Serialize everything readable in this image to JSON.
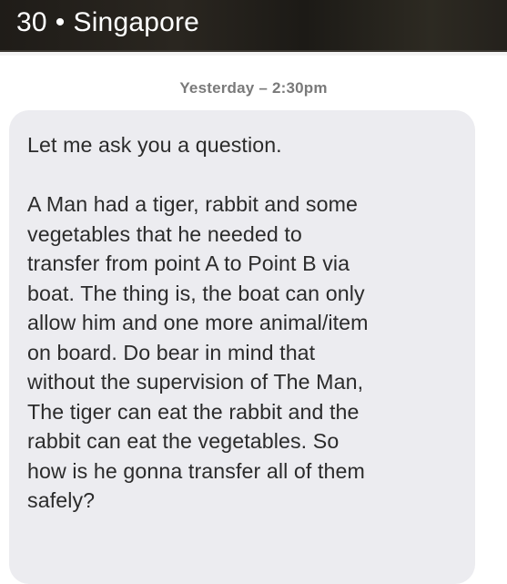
{
  "header": {
    "age": "30",
    "separator": "•",
    "location": "Singapore"
  },
  "timestamp": "Yesterday – 2:30pm",
  "message": {
    "first_line": "Let me ask you a question.",
    "lines": [
      "A Man had a tiger, rabbit and some",
      "vegetables that he needed to",
      "transfer from point A to Point B via",
      "boat. The thing is, the boat can only",
      "allow him and one more animal/item",
      "on board. Do bear in mind that",
      "without the supervision of The Man,",
      "The tiger can eat the rabbit and the",
      "rabbit can eat the vegetables. So",
      "how is he gonna transfer all of them",
      "safely?"
    ]
  }
}
